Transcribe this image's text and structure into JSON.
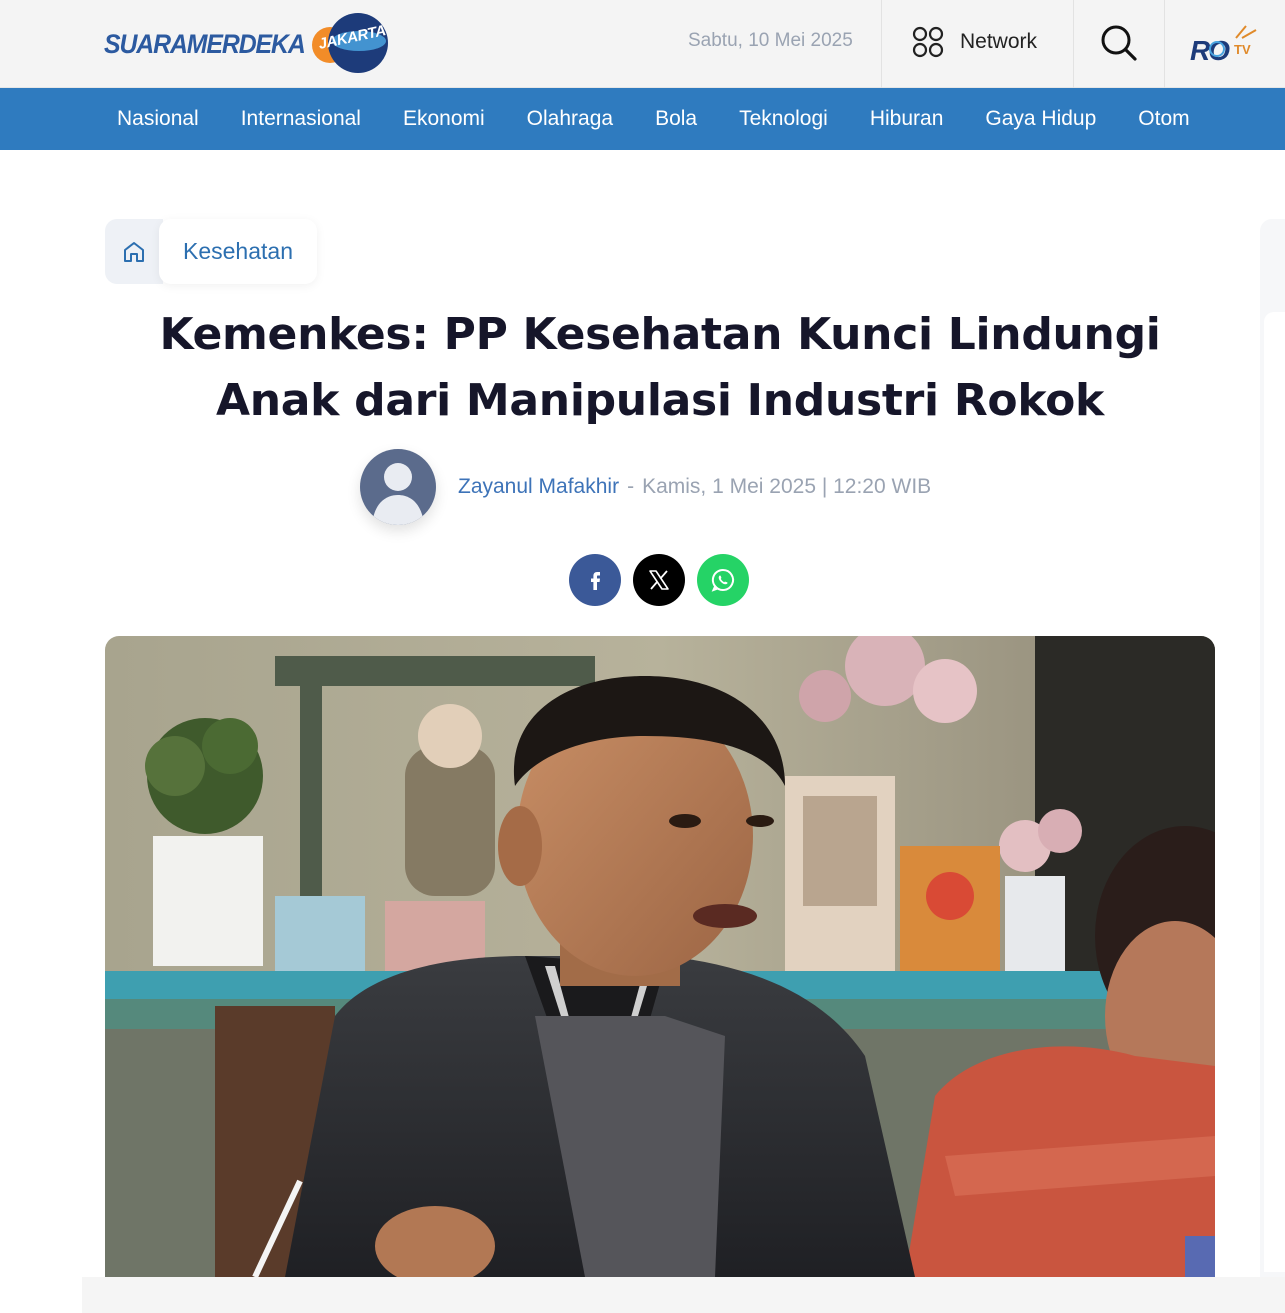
{
  "header": {
    "logo_text": "SUARAMERDEKA",
    "logo_badge": "JAKARTA",
    "date": "Sabtu, 10 Mei 2025",
    "network_label": "Network",
    "search_icon": "search-icon",
    "partner_logo": "RO TV"
  },
  "nav": {
    "items": [
      "Nasional",
      "Internasional",
      "Ekonomi",
      "Olahraga",
      "Bola",
      "Teknologi",
      "Hiburan",
      "Gaya Hidup",
      "Otom"
    ]
  },
  "breadcrumb": {
    "home_icon": "home-icon",
    "category": "Kesehatan"
  },
  "article": {
    "title": "Kemenkes: PP Kesehatan Kunci Lindungi Anak dari Manipulasi Industri Rokok",
    "author": "Zayanul Mafakhir",
    "separator": "-",
    "published": "Kamis, 1 Mei 2025 | 12:20 WIB"
  },
  "share": {
    "buttons": [
      {
        "name": "facebook",
        "icon": "facebook-icon",
        "color": "#3b5998"
      },
      {
        "name": "x",
        "icon": "x-icon",
        "color": "#000000"
      },
      {
        "name": "whatsapp",
        "icon": "whatsapp-icon",
        "color": "#25d366"
      }
    ]
  },
  "colors": {
    "nav_bg": "#2f7bbf",
    "brand_blue": "#2c5aa0",
    "link_blue": "#3d73b8",
    "accent_orange": "#f28c28"
  }
}
